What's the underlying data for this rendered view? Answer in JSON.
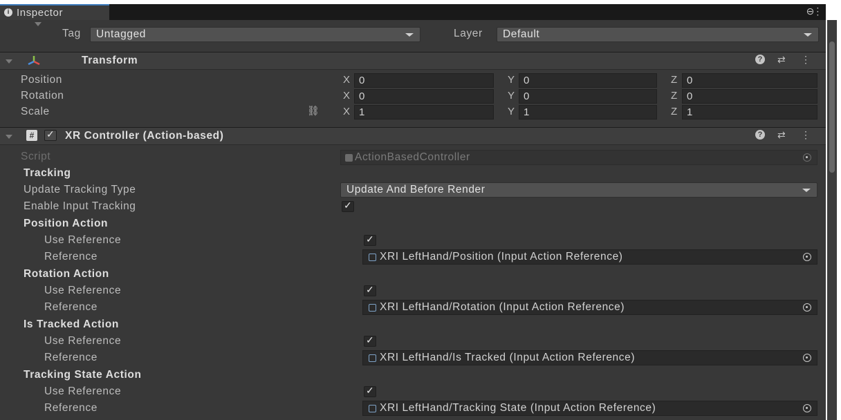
{
  "window": {
    "tab_label": "Inspector"
  },
  "gameobject": {
    "tag_label": "Tag",
    "tag_value": "Untagged",
    "layer_label": "Layer",
    "layer_value": "Default"
  },
  "transform": {
    "title": "Transform",
    "rows": [
      {
        "label": "Position",
        "x": "0",
        "y": "0",
        "z": "0"
      },
      {
        "label": "Rotation",
        "x": "0",
        "y": "0",
        "z": "0"
      },
      {
        "label": "Scale",
        "x": "1",
        "y": "1",
        "z": "1"
      }
    ],
    "axis": {
      "x": "X",
      "y": "Y",
      "z": "Z"
    }
  },
  "component": {
    "title": "XR Controller (Action-based)",
    "script_label": "Script",
    "script_value": "ActionBasedController",
    "tracking_header": "Tracking",
    "update_tracking_label": "Update Tracking Type",
    "update_tracking_value": "Update And Before Render",
    "enable_input_label": "Enable Input Tracking",
    "actions": [
      {
        "header": "Position Action",
        "use_ref": "Use Reference",
        "ref_label": "Reference",
        "ref_value": "XRI LeftHand/Position (Input Action Reference)"
      },
      {
        "header": "Rotation Action",
        "use_ref": "Use Reference",
        "ref_label": "Reference",
        "ref_value": "XRI LeftHand/Rotation (Input Action Reference)"
      },
      {
        "header": "Is Tracked Action",
        "use_ref": "Use Reference",
        "ref_label": "Reference",
        "ref_value": "XRI LeftHand/Is Tracked (Input Action Reference)"
      },
      {
        "header": "Tracking State Action",
        "use_ref": "Use Reference",
        "ref_label": "Reference",
        "ref_value": "XRI LeftHand/Tracking State (Input Action Reference)"
      }
    ]
  },
  "glyphs": {
    "check": "✓",
    "kebab": "⋮",
    "help": "?",
    "presets": "⇄",
    "lock": "⊖",
    "link": "⛓"
  },
  "colors": {
    "accent": "#3a79bb",
    "panel": "#383838",
    "field": "#2a2a2a",
    "header": "#3e3e3e"
  }
}
